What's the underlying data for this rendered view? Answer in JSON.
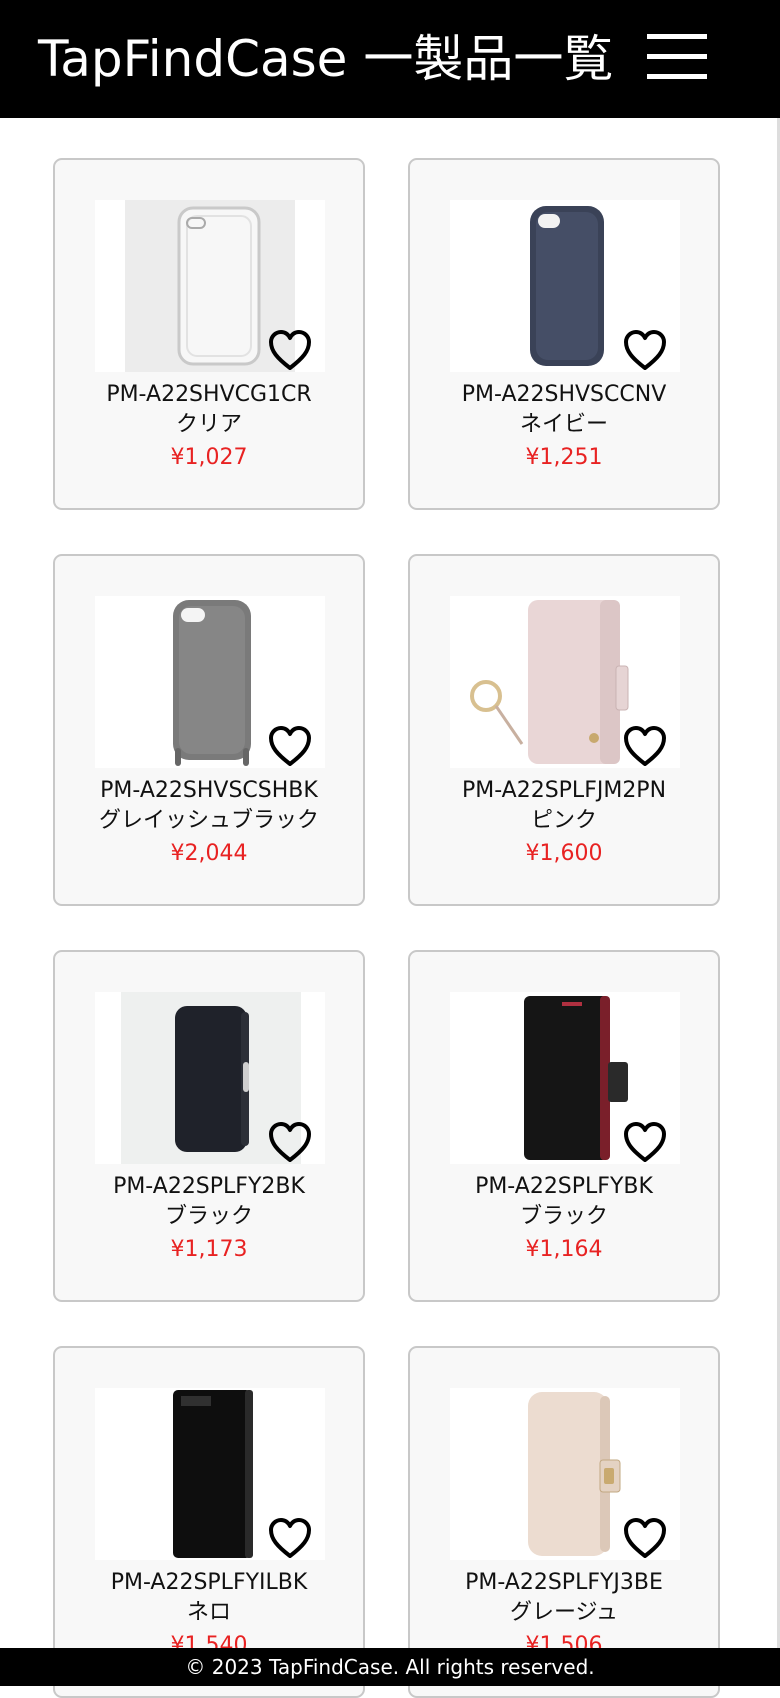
{
  "header": {
    "title": "TapFindCase 一製品一覧",
    "menu_icon": "hamburger-menu-icon"
  },
  "colors": {
    "header_bg": "#000000",
    "price": "#e82222",
    "card_bg": "#f8f8f8",
    "card_border": "#c8c8c8"
  },
  "products": [
    {
      "code": "PM-A22SHVCG1CR",
      "color": "クリア",
      "price": "¥1,027",
      "image": "clear-phone-case-image"
    },
    {
      "code": "PM-A22SHVSCCNV",
      "color": "ネイビー",
      "price": "¥1,251",
      "image": "navy-phone-case-image"
    },
    {
      "code": "PM-A22SHVSCSHBK",
      "color": "グレイッシュブラック",
      "price": "¥2,044",
      "image": "grey-shoulder-case-image"
    },
    {
      "code": "PM-A22SPLFJM2PN",
      "color": "ピンク",
      "price": "¥1,600",
      "image": "pink-flip-case-image"
    },
    {
      "code": "PM-A22SPLFY2BK",
      "color": "ブラック",
      "price": "¥1,173",
      "image": "black-flip-case-image"
    },
    {
      "code": "PM-A22SPLFYBK",
      "color": "ブラック",
      "price": "¥1,164",
      "image": "black-red-flip-case-image"
    },
    {
      "code": "PM-A22SPLFYILBK",
      "color": "ネロ",
      "price": "¥1,540",
      "image": "nero-flip-case-image"
    },
    {
      "code": "PM-A22SPLFYJ3BE",
      "color": "グレージュ",
      "price": "¥1,506",
      "image": "greige-flip-case-image"
    }
  ],
  "footer": {
    "text": "© 2023 TapFindCase. All rights reserved."
  }
}
